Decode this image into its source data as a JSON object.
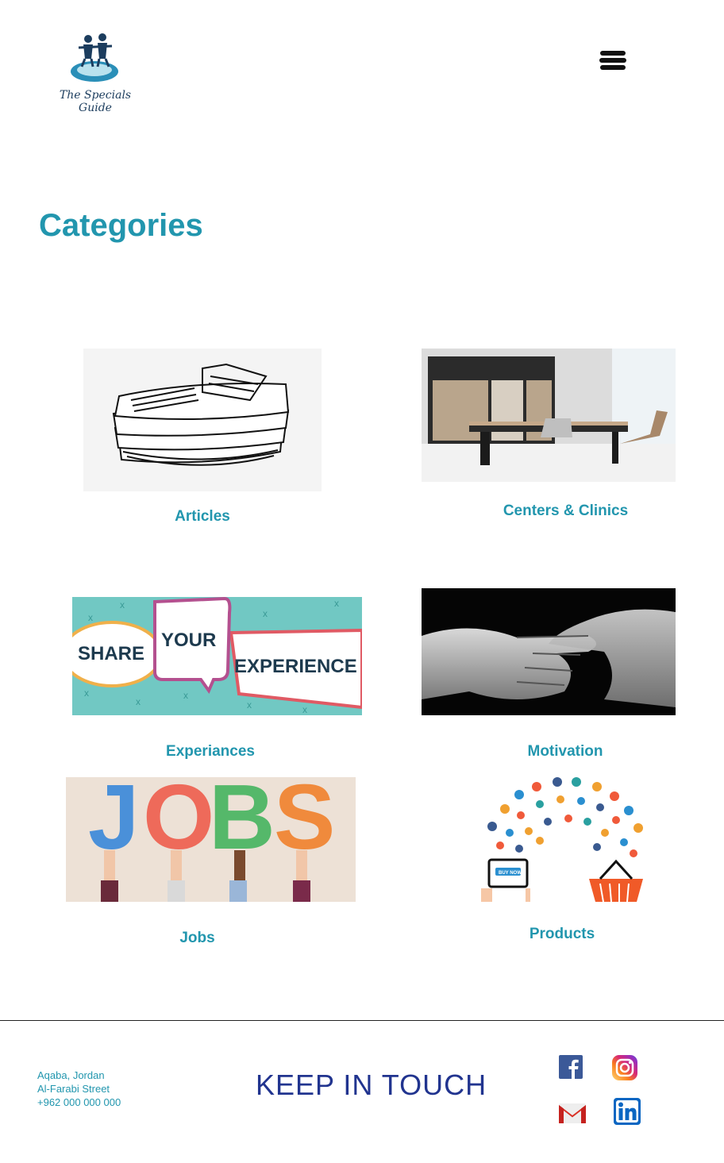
{
  "header": {
    "brand_name": "The Specials Guide",
    "menu_icon": "hamburger-menu-icon"
  },
  "main": {
    "title": "Categories",
    "categories": [
      {
        "label": "Articles",
        "image": "newspaper-stack-illustration"
      },
      {
        "label": "Centers & Clinics",
        "image": "office-room-photo"
      },
      {
        "label": "Experiances",
        "image": "share-your-experience-banner"
      },
      {
        "label": "Motivation",
        "image": "handshake-photo"
      },
      {
        "label": "Jobs",
        "image": "jobs-letters-photo"
      },
      {
        "label": "Products",
        "image": "shopping-products-illustration"
      }
    ],
    "banner_text": {
      "share": "SHARE",
      "your": "YOUR",
      "experience": "EXPERIENCE",
      "jobs_letters": [
        "J",
        "O",
        "B",
        "S"
      ],
      "buy_now": "BUY NOW"
    }
  },
  "footer": {
    "address": [
      "Aqaba, Jordan",
      "Al-Farabi Street",
      "+962 000 000 000"
    ],
    "heading": "KEEP IN TOUCH",
    "social": [
      {
        "name": "facebook",
        "icon": "facebook-icon"
      },
      {
        "name": "instagram",
        "icon": "instagram-icon"
      },
      {
        "name": "gmail",
        "icon": "gmail-icon"
      },
      {
        "name": "linkedin",
        "icon": "linkedin-icon"
      }
    ]
  },
  "colors": {
    "accent": "#2296ae",
    "footer_heading": "#21348f",
    "facebook": "#3b5998",
    "linkedin": "#0a66c2",
    "gmail_red": "#d93025"
  }
}
